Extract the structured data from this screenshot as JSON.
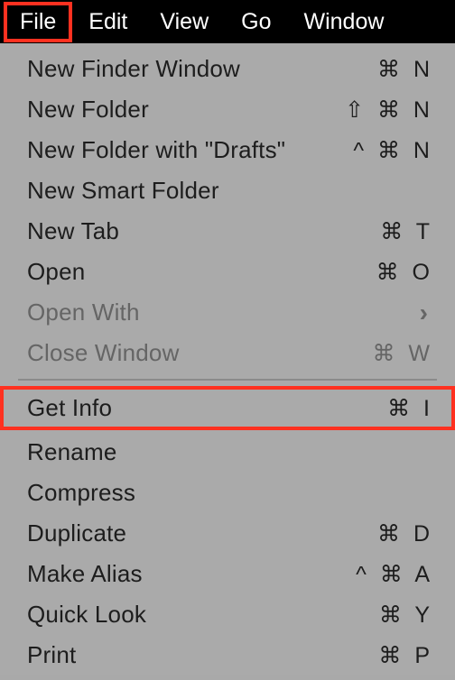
{
  "menubar": {
    "items": [
      {
        "label": "File"
      },
      {
        "label": "Edit"
      },
      {
        "label": "View"
      },
      {
        "label": "Go"
      },
      {
        "label": "Window"
      }
    ]
  },
  "dropdown": {
    "items": [
      {
        "label": "New Finder Window",
        "shortcut": "⌘ N",
        "disabled": false
      },
      {
        "label": "New Folder",
        "shortcut": "⇧ ⌘ N",
        "disabled": false
      },
      {
        "label": "New Folder with \"Drafts\"",
        "shortcut": "^ ⌘ N",
        "disabled": false
      },
      {
        "label": "New Smart Folder",
        "shortcut": "",
        "disabled": false
      },
      {
        "label": "New Tab",
        "shortcut": "⌘ T",
        "disabled": false
      },
      {
        "label": "Open",
        "shortcut": "⌘ O",
        "disabled": false
      },
      {
        "label": "Open With",
        "shortcut": "",
        "submenu": true,
        "disabled": true
      },
      {
        "label": "Close Window",
        "shortcut": "⌘ W",
        "disabled": true
      },
      {
        "separator": true
      },
      {
        "label": "Get Info",
        "shortcut": "⌘  I",
        "disabled": false,
        "highlighted": true
      },
      {
        "label": "Rename",
        "shortcut": "",
        "disabled": false
      },
      {
        "label": "Compress",
        "shortcut": "",
        "disabled": false
      },
      {
        "label": "Duplicate",
        "shortcut": "⌘ D",
        "disabled": false
      },
      {
        "label": "Make Alias",
        "shortcut": "^ ⌘ A",
        "disabled": false
      },
      {
        "label": "Quick Look",
        "shortcut": "⌘ Y",
        "disabled": false
      },
      {
        "label": "Print",
        "shortcut": "⌘ P",
        "disabled": false
      }
    ]
  }
}
